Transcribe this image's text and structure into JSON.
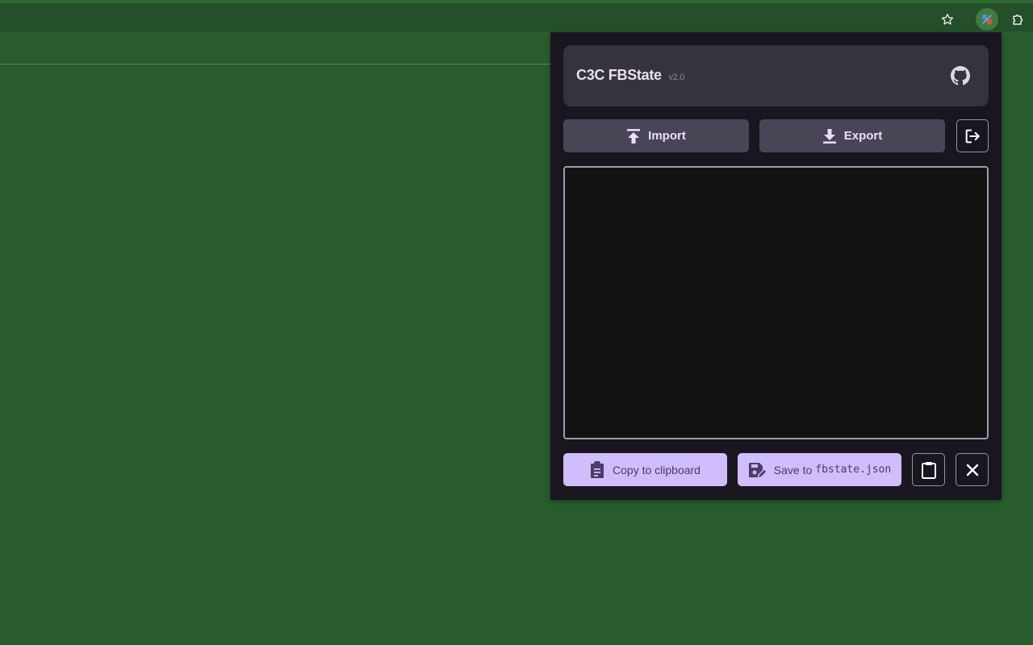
{
  "colors": {
    "page_background": "#285c2c",
    "browser_toolbar": "#254f28",
    "popup_background": "#1a1620",
    "header_card": "#37333d",
    "tonal_button": "#4a4457",
    "filled_button": "#d1bcfc",
    "textarea_background": "#131313"
  },
  "browser": {
    "icons": [
      "star-icon",
      "extension-active-icon",
      "puzzle-icon"
    ]
  },
  "popup": {
    "title": "C3C FBState",
    "version": "v2.0",
    "github_icon": "github-icon",
    "actions": {
      "import_label": "Import",
      "export_label": "Export",
      "logout_icon": "logout-icon"
    },
    "state_text": "",
    "footer": {
      "copy_label": "Copy to clipboard",
      "save_prefix": "Save to",
      "save_filename": "fbstate.json",
      "paste_icon": "clipboard-icon",
      "close_icon": "close-icon"
    }
  }
}
